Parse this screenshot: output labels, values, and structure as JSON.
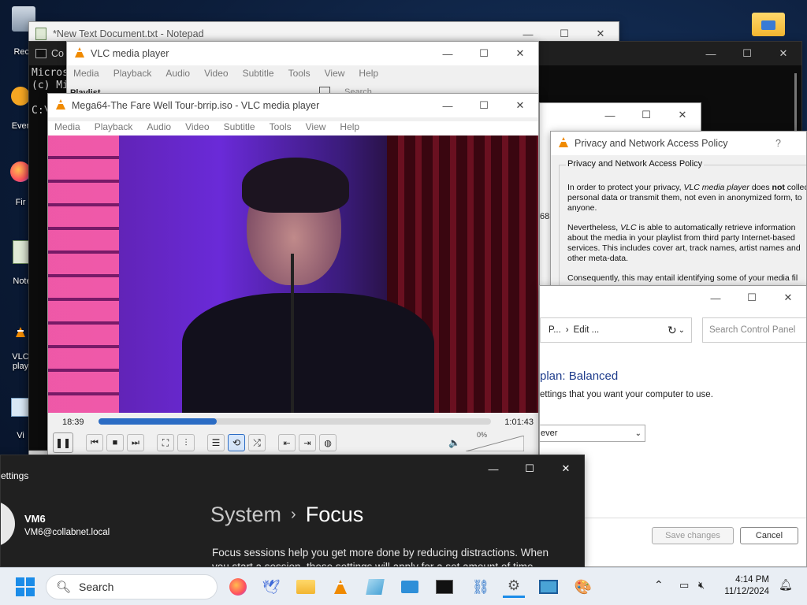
{
  "desktop": {
    "icons": [
      {
        "label": "Recy",
        "glyph": "🗑"
      },
      {
        "label": "Ever",
        "glyph": "◉"
      },
      {
        "label": "Fir",
        "glyph": "🦊"
      },
      {
        "label": "Note",
        "glyph": "📝"
      },
      {
        "label": "VLC\nplay",
        "glyph": "▲"
      },
      {
        "label": "Vi",
        "glyph": "▤"
      }
    ],
    "folder_icon": "folder-icon"
  },
  "notepad": {
    "title": "*New Text Document.txt - Notepad"
  },
  "cmd": {
    "title": "Co",
    "lines": [
      "Micros",
      "(c) Mi",
      "",
      "C:\\"
    ]
  },
  "vlc_back": {
    "title": "VLC media player",
    "menu": [
      "Media",
      "Playback",
      "Audio",
      "Video",
      "Subtitle",
      "Tools",
      "View",
      "Help"
    ],
    "playlist_label": "Playlist",
    "search_placeholder": "Search"
  },
  "vlc_main": {
    "title": "Mega64-The Fare Well Tour-brrip.iso - VLC media player",
    "menu": [
      "Media",
      "Playback",
      "Audio",
      "Video",
      "Subtitle",
      "Tools",
      "View",
      "Help"
    ],
    "time_elapsed": "18:39",
    "time_total": "1:01:43",
    "progress": 0.302,
    "volume_label": "0%",
    "volume": 0.0
  },
  "back_window_number": "68",
  "privacy": {
    "title": "Privacy and Network Access Policy",
    "help": "?",
    "heading": "Privacy and Network Access Policy",
    "p1_a": "In order to protect your privacy, ",
    "p1_em": "VLC media player",
    "p1_b": " does ",
    "p1_strong": "not",
    "p1_c": " collect personal data or transmit them, not even in anonymized form, to anyone.",
    "p2_a": "Nevertheless, ",
    "p2_em": "VLC",
    "p2_b": " is able to automatically retrieve information about the media in your playlist from third party Internet-based services. This includes cover art, track names, artist names and other meta-data.",
    "p3": "Consequently, this may entail identifying some of your media fil"
  },
  "control_panel": {
    "breadcrumb_1": "P...",
    "breadcrumb_sep": "›",
    "breadcrumb_2": "Edit ...",
    "search_placeholder": "Search Control Panel",
    "plan_title": "plan: Balanced",
    "plan_desc": "ettings that you want your computer to use.",
    "select_value": "ever",
    "save_label": "Save changes",
    "cancel_label": "Cancel"
  },
  "settings": {
    "title": "ettings",
    "user_name": "VM6",
    "user_email": "VM6@collabnet.local",
    "crumb_parent": "System",
    "crumb_sep": "›",
    "crumb_current": "Focus",
    "body": "Focus sessions help you get more done by reducing distractions. When you start a session, these settings will apply for a set amount of time."
  },
  "taskbar": {
    "search_label": "Search",
    "time": "4:14 PM",
    "date": "11/12/2024",
    "apps": [
      "firefox-icon",
      "bird-app-icon",
      "file-explorer-icon",
      "vlc-icon",
      "notepad-icon",
      "window-app-icon",
      "terminal-icon",
      "network-app-icon",
      "settings-icon",
      "remote-desktop-icon",
      "paint-icon"
    ]
  }
}
